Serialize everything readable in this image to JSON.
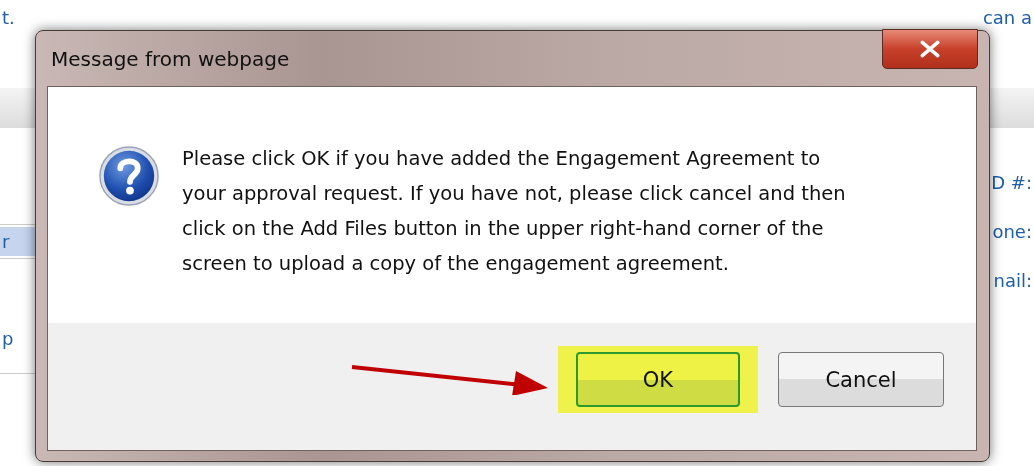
{
  "page": {
    "notice_fragments": [
      "t.",
      "can a"
    ],
    "left_fragments": [
      {
        "text": "r",
        "selected": true
      },
      {
        "text": "p",
        "selected": false
      }
    ],
    "right_fragments": [
      "D #:",
      "one:",
      "nail:"
    ]
  },
  "dialog": {
    "title": "Message from webpage",
    "message": "Please click OK if you have added the Engagement Agreement to your approval request.  If you have not, please click cancel and then click on the Add Files button in the upper right-hand corner of the screen to upload a copy of the engagement agreement.",
    "buttons": [
      {
        "label": "OK",
        "kind": "default",
        "highlighted": true
      },
      {
        "label": "Cancel",
        "kind": "normal",
        "highlighted": false
      }
    ]
  }
}
